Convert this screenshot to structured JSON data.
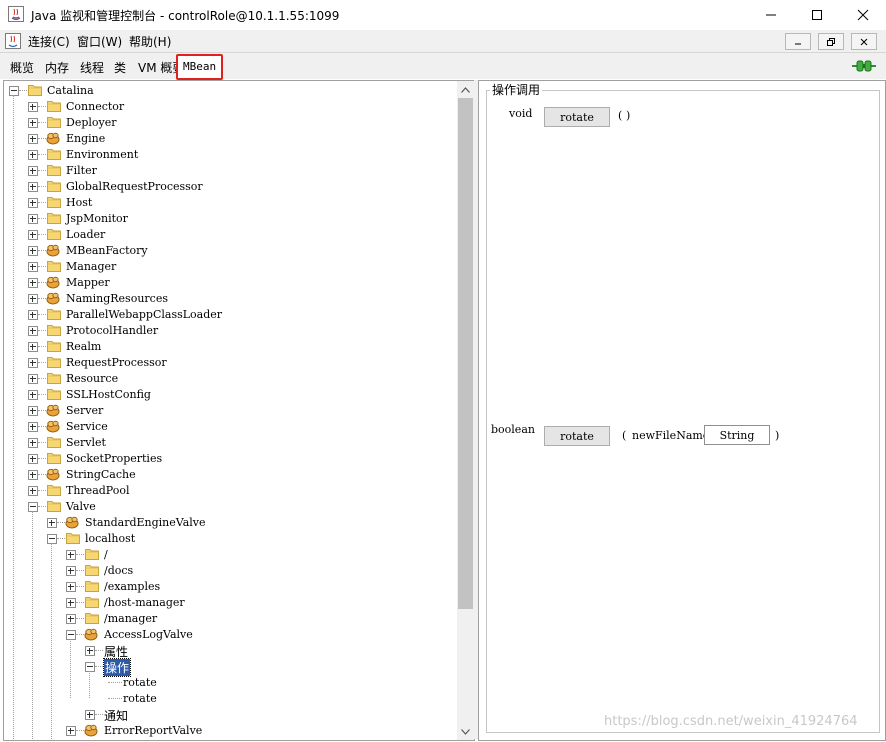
{
  "window": {
    "title": "Java 监视和管理控制台 - controlRole@10.1.1.55:1099"
  },
  "menu": {
    "connect": "连接(C)",
    "window": "窗口(W)",
    "help": "帮助(H)"
  },
  "tabs": [
    {
      "label": "概览"
    },
    {
      "label": "内存"
    },
    {
      "label": "线程"
    },
    {
      "label": "类"
    },
    {
      "label": "VM 概要"
    },
    {
      "label": "MBean"
    }
  ],
  "tree": {
    "root": "Catalina",
    "items": [
      {
        "label": "Connector",
        "icon": "folder"
      },
      {
        "label": "Deployer",
        "icon": "folder"
      },
      {
        "label": "Engine",
        "icon": "bean"
      },
      {
        "label": "Environment",
        "icon": "folder"
      },
      {
        "label": "Filter",
        "icon": "folder"
      },
      {
        "label": "GlobalRequestProcessor",
        "icon": "folder"
      },
      {
        "label": "Host",
        "icon": "folder"
      },
      {
        "label": "JspMonitor",
        "icon": "folder"
      },
      {
        "label": "Loader",
        "icon": "folder"
      },
      {
        "label": "MBeanFactory",
        "icon": "bean"
      },
      {
        "label": "Manager",
        "icon": "folder"
      },
      {
        "label": "Mapper",
        "icon": "bean"
      },
      {
        "label": "NamingResources",
        "icon": "bean"
      },
      {
        "label": "ParallelWebappClassLoader",
        "icon": "folder"
      },
      {
        "label": "ProtocolHandler",
        "icon": "folder"
      },
      {
        "label": "Realm",
        "icon": "folder"
      },
      {
        "label": "RequestProcessor",
        "icon": "folder"
      },
      {
        "label": "Resource",
        "icon": "folder"
      },
      {
        "label": "SSLHostConfig",
        "icon": "folder"
      },
      {
        "label": "Server",
        "icon": "bean"
      },
      {
        "label": "Service",
        "icon": "bean"
      },
      {
        "label": "Servlet",
        "icon": "folder"
      },
      {
        "label": "SocketProperties",
        "icon": "folder"
      },
      {
        "label": "StringCache",
        "icon": "bean"
      },
      {
        "label": "ThreadPool",
        "icon": "folder"
      },
      {
        "label": "Valve",
        "icon": "folder"
      }
    ],
    "valve": {
      "standard_engine_valve": "StandardEngineValve",
      "localhost": "localhost",
      "contexts": [
        "/",
        "/docs",
        "/examples",
        "/host-manager",
        "/manager"
      ],
      "access_log_valve": "AccessLogValve",
      "attributes": "属性",
      "operations": "操作",
      "operation_items": [
        "rotate",
        "rotate"
      ],
      "notifications": "通知",
      "error_report_valve": "ErrorReportValve"
    }
  },
  "operations_panel": {
    "legend": "操作调用",
    "ops": [
      {
        "return_type": "void",
        "button": "rotate",
        "open": "(",
        "close": ")"
      },
      {
        "return_type": "boolean",
        "button": "rotate",
        "open": "(",
        "param_name": "newFileName",
        "param_value": "String",
        "close": ")"
      }
    ]
  },
  "watermark": "https://blog.csdn.net/weixin_41924764"
}
